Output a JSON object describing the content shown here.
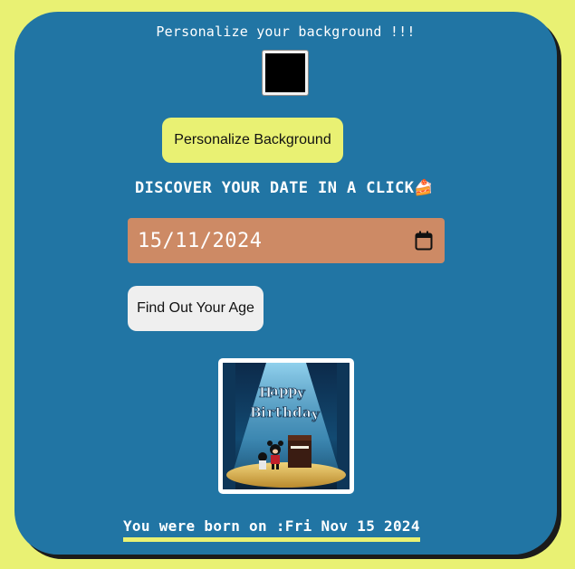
{
  "header": {
    "title": "Personalize your background !!!"
  },
  "color_picker": {
    "value": "#000000"
  },
  "buttons": {
    "personalize_label": "Personalize Background",
    "age_label": "Find Out Your Age"
  },
  "discover": {
    "heading": "DISCOVER YOUR DATE IN A CLICK",
    "emoji": "🍰"
  },
  "date_field": {
    "value": "15/11/2024",
    "icon": "calendar-icon"
  },
  "image": {
    "caption_art": "Happy Birthday"
  },
  "result": {
    "prefix": "You were born on :",
    "date": "Fri Nov 15 2024"
  },
  "colors": {
    "page_bg": "#e9f173",
    "card_bg": "#2175a4",
    "date_field_bg": "#cd8a65",
    "accent": "#e9f173"
  }
}
